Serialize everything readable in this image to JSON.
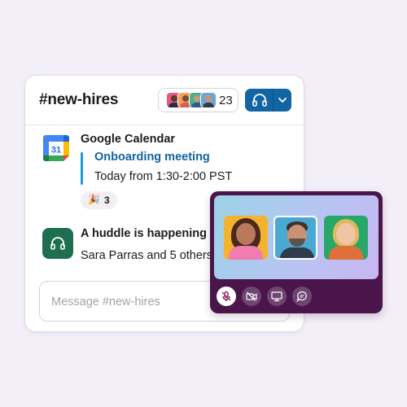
{
  "channel": {
    "name": "#new-hires",
    "member_count": "23"
  },
  "messages": [
    {
      "sender": "Google Calendar",
      "icon": "google-calendar-icon",
      "calendar_day": "31",
      "event_title": "Onboarding meeting",
      "event_time": "Today from 1:30-2:00 PST",
      "reaction": {
        "emoji": "🎉",
        "count": "3"
      }
    },
    {
      "title": "A huddle is happening",
      "icon": "headphones-icon",
      "subtitle": "Sara Parras and 5 others"
    }
  ],
  "composer": {
    "placeholder": "Message #new-hires"
  },
  "huddle_window": {
    "controls": [
      "mute-mic-icon",
      "video-off-icon",
      "screen-share-icon",
      "chat-bubble-icon"
    ]
  },
  "colors": {
    "accent_blue": "#1264a3",
    "huddle_purple": "#4a154b",
    "huddle_green": "#1f6e50",
    "background": "#f3eff8"
  }
}
